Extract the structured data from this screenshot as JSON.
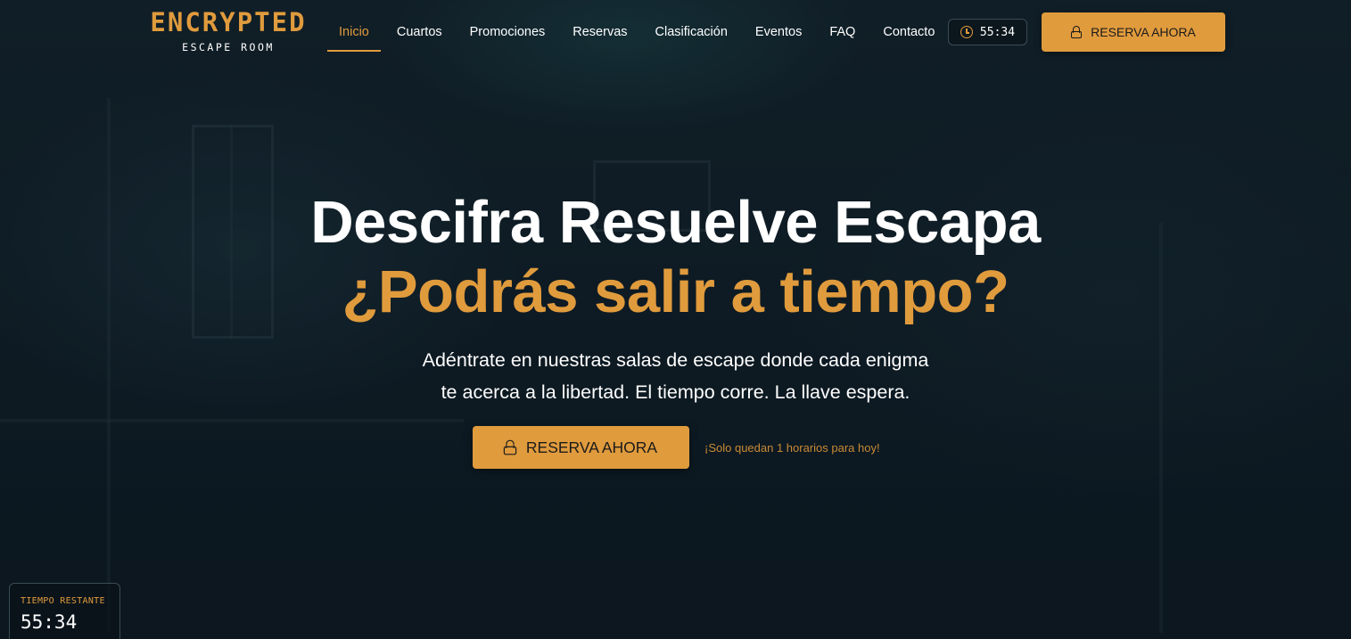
{
  "brand": {
    "name": "ENCRYPTED",
    "tagline": "ESCAPE ROOM"
  },
  "nav": {
    "items": [
      {
        "label": "Inicio",
        "active": true
      },
      {
        "label": "Cuartos",
        "active": false
      },
      {
        "label": "Promociones",
        "active": false
      },
      {
        "label": "Reservas",
        "active": false
      },
      {
        "label": "Clasificación",
        "active": false
      },
      {
        "label": "Eventos",
        "active": false
      },
      {
        "label": "FAQ",
        "active": false
      },
      {
        "label": "Contacto",
        "active": false
      }
    ],
    "timer": "55:34",
    "cta_label": "RESERVA AHORA"
  },
  "hero": {
    "title": "Descifra Resuelve Escapa",
    "question": "¿Podrás salir a tiempo?",
    "text_line1": "Adéntrate en nuestras salas de escape donde cada enigma",
    "text_line2": "te acerca a la libertad. El tiempo corre. La llave espera.",
    "cta_label": "RESERVA AHORA",
    "slots_note": "¡Solo quedan 1 horarios para hoy!"
  },
  "countdown": {
    "label": "TIEMPO RESTANTE",
    "value": "55:34"
  },
  "colors": {
    "accent": "#e09b3d",
    "background": "#0f1c24",
    "text": "#ffffff"
  },
  "icons": {
    "timer": "clock-icon",
    "cta": "lock-icon"
  }
}
